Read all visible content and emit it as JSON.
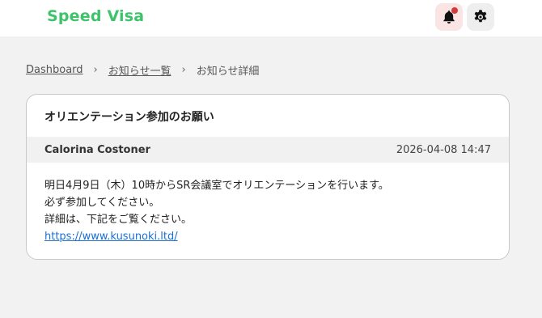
{
  "header": {
    "brand": "Speed Visa",
    "icons": {
      "notifications": "bell-icon",
      "settings": "gear-icon"
    },
    "colors": {
      "brand": "#3ec36a",
      "notification_badge": "#d23b3b"
    }
  },
  "breadcrumb": {
    "items": [
      {
        "label": "Dashboard"
      },
      {
        "label": "お知らせ一覧"
      },
      {
        "label": "お知らせ詳細"
      }
    ],
    "separator": "›"
  },
  "notice": {
    "title": "オリエンテーション参加のお願い",
    "author": "Calorina Costoner",
    "timestamp": "2026-04-08 14:47",
    "body_lines": [
      "明日4月9日（木）10時からSR会議室でオリエンテーションを行います。",
      "必ず参加してください。",
      "詳細は、下記をご覧ください。"
    ],
    "link": "https://www.kusunoki.ltd/"
  }
}
